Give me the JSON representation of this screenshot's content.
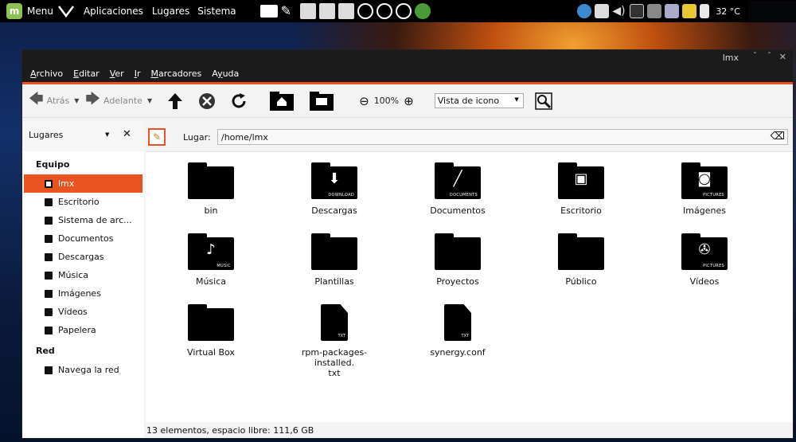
{
  "panel": {
    "menu_label": "Menu",
    "applications": "Aplicaciones",
    "places": "Lugares",
    "system": "Sistema",
    "temperature": "32 °C"
  },
  "window": {
    "title": "lmx",
    "menu": [
      "Archivo",
      "Editar",
      "Ver",
      "Ir",
      "Marcadores",
      "Ayuda"
    ],
    "menu_mnemonic_index": [
      0,
      0,
      0,
      0,
      0,
      1
    ]
  },
  "toolbar": {
    "back_label": "Atrás",
    "forward_label": "Adelante",
    "zoom_level": "100%",
    "view_mode": "Vista de icono"
  },
  "sidebar": {
    "header": "Lugares",
    "sections": [
      {
        "title": "Equipo",
        "items": [
          {
            "label": "lmx",
            "selected": true
          },
          {
            "label": "Escritorio"
          },
          {
            "label": "Sistema de arc..."
          },
          {
            "label": "Documentos"
          },
          {
            "label": "Descargas"
          },
          {
            "label": "Música"
          },
          {
            "label": "Imágenes"
          },
          {
            "label": "Vídeos"
          },
          {
            "label": "Papelera"
          }
        ]
      },
      {
        "title": "Red",
        "items": [
          {
            "label": "Navega la red"
          }
        ]
      }
    ]
  },
  "location": {
    "label": "Lugar:",
    "path": "/home/lmx"
  },
  "files": [
    {
      "name": "bin",
      "kind": "folder",
      "glyph": "",
      "caption": ""
    },
    {
      "name": "Descargas",
      "kind": "folder",
      "glyph": "⬇",
      "caption": "DOWNLOAD"
    },
    {
      "name": "Documentos",
      "kind": "folder",
      "glyph": "╱",
      "caption": "DOCUMENTS"
    },
    {
      "name": "Escritorio",
      "kind": "folder",
      "glyph": "▣",
      "caption": ""
    },
    {
      "name": "Imágenes",
      "kind": "folder",
      "glyph": "◙",
      "caption": "PICTURES"
    },
    {
      "name": "Música",
      "kind": "folder",
      "glyph": "♪",
      "caption": "MUSIC"
    },
    {
      "name": "Plantillas",
      "kind": "folder",
      "glyph": "",
      "caption": ""
    },
    {
      "name": "Proyectos",
      "kind": "folder",
      "glyph": "",
      "caption": ""
    },
    {
      "name": "Público",
      "kind": "folder",
      "glyph": "",
      "caption": ""
    },
    {
      "name": "Vídeos",
      "kind": "folder",
      "glyph": "✇",
      "caption": "PICTURES"
    },
    {
      "name": "Virtual Box",
      "kind": "folder",
      "glyph": "",
      "caption": ""
    },
    {
      "name": "rpm-packages-installed.\ntxt",
      "kind": "doc",
      "glyph": "",
      "caption": "TXT"
    },
    {
      "name": "synergy.conf",
      "kind": "doc",
      "glyph": "",
      "caption": "TXT"
    }
  ],
  "status": "13 elementos, espacio libre: 111,6 GB"
}
